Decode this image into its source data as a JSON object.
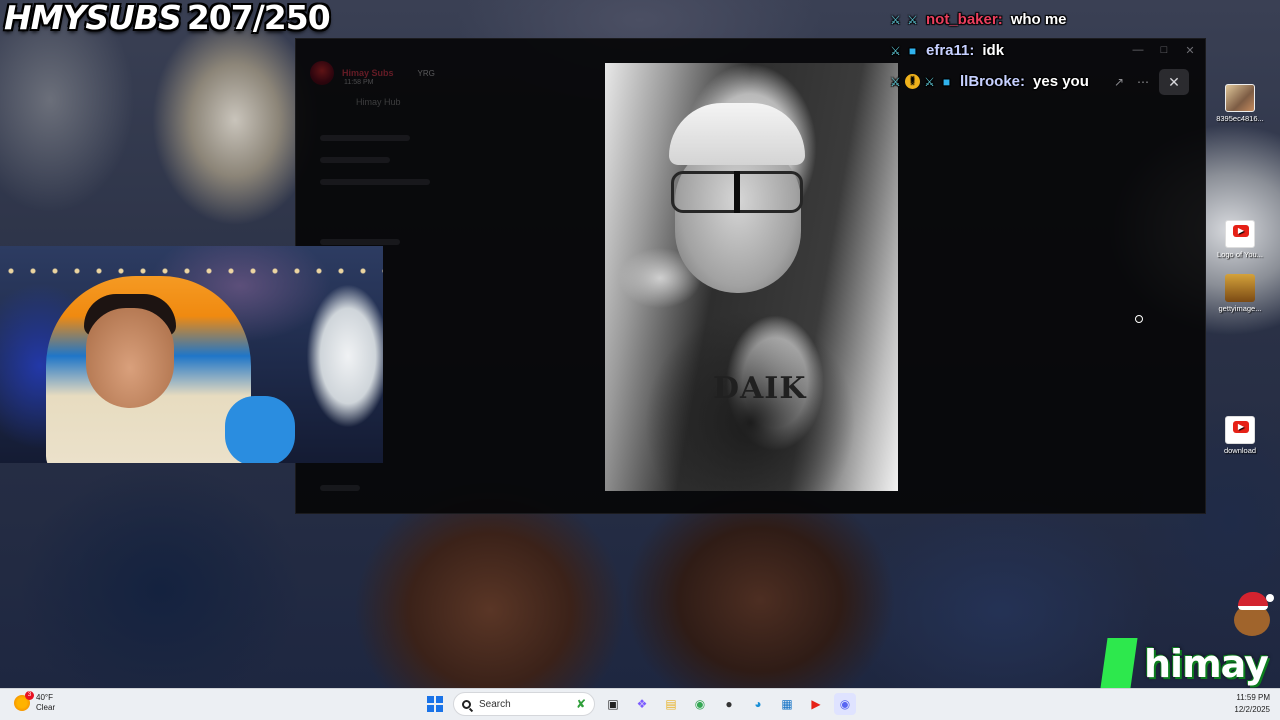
{
  "overlay": {
    "subs_label": "HMYSUBS",
    "subs_count": "207/250"
  },
  "chat": [
    {
      "user": "not_baker:",
      "message": "who me",
      "badges": [
        "sword-badge",
        "sword-badge"
      ],
      "user_color": "#ea3f5e"
    },
    {
      "user": "efra11:",
      "message": "idk",
      "badges": [
        "sword-badge",
        "cube-badge"
      ],
      "user_color": "#c6d0ff"
    },
    {
      "user": "llBrooke:",
      "message": "yes you",
      "badges": [
        "sword-badge",
        "warning-badge",
        "sword-badge",
        "cube-badge"
      ],
      "user_color": "#c6d0ff"
    }
  ],
  "viewer": {
    "window_controls": [
      "minimize-icon",
      "maximize-icon",
      "close-icon"
    ],
    "background_app": {
      "username": "Himay Subs",
      "badge": "YRG",
      "time": "11:58 PM",
      "channel": "Himay Hub"
    },
    "photo": {
      "shirt_text": "DAIK"
    },
    "toolbar": {
      "open_external_icon": "open-external-icon",
      "more_icon": "more-icon",
      "close_icon": "close-icon"
    }
  },
  "desktop_icons": [
    {
      "label": "8395ec4816...",
      "icon": "image-file-icon"
    },
    {
      "label": "Logo of You...",
      "icon": "youtube-icon"
    },
    {
      "label": "gettyimage...",
      "icon": "image-file-icon"
    },
    {
      "label": "download",
      "icon": "youtube-icon"
    }
  ],
  "logo": {
    "text": "himay"
  },
  "taskbar": {
    "weather_temp": "40°F",
    "weather_desc": "Clear",
    "weather_alert_count": "3",
    "search_placeholder": "Search",
    "apps": [
      "task-view-icon",
      "copilot-icon",
      "file-explorer-icon",
      "chrome-icon",
      "obs-icon",
      "edge-icon",
      "store-icon",
      "youtube-icon",
      "discord-icon"
    ],
    "time": "11:59 PM",
    "date": "12/2/2025"
  },
  "colors": {
    "accent_green": "#2de84d",
    "chat_red_user": "#ea3f5e",
    "youtube_red": "#e62117"
  }
}
